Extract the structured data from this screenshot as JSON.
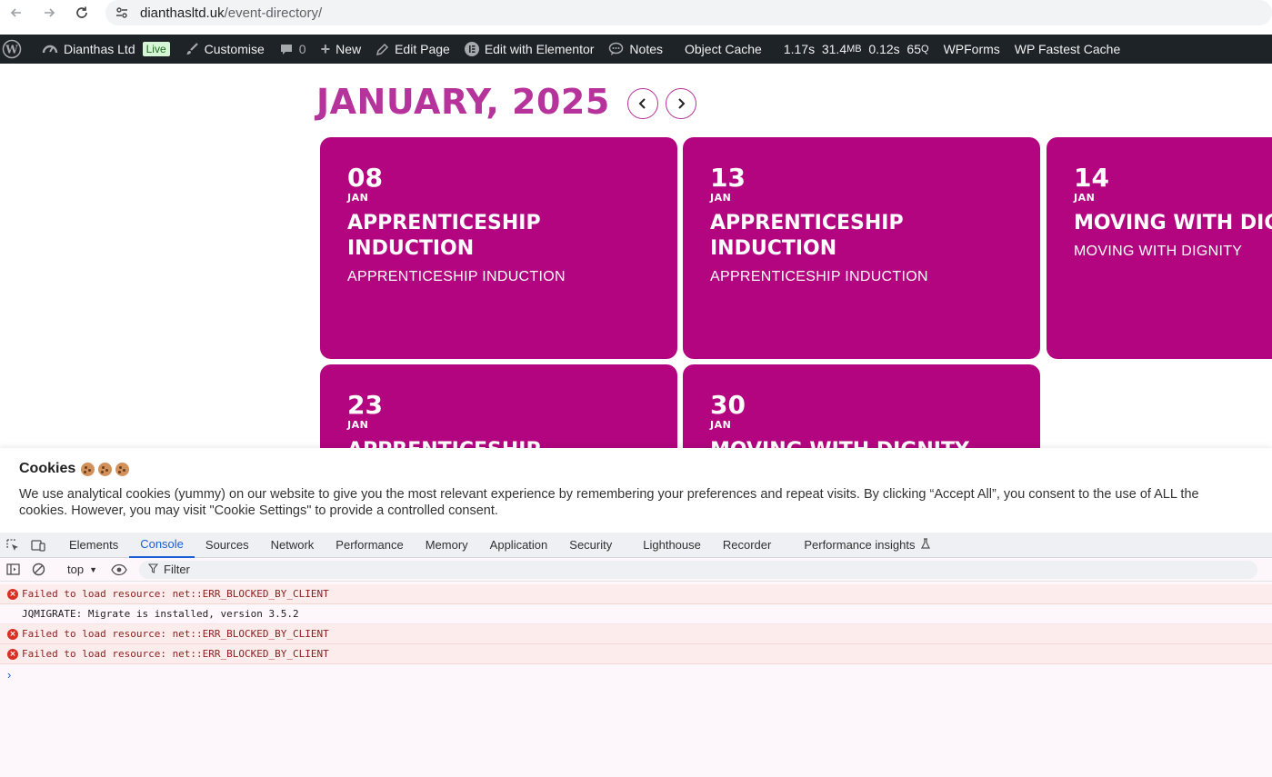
{
  "browser": {
    "url_host": "dianthasltd.uk",
    "url_path": "/event-directory/"
  },
  "adminbar": {
    "site_name": "Dianthas Ltd",
    "live": "Live",
    "customise": "Customise",
    "comments_count": "0",
    "new": "New",
    "edit_page": "Edit Page",
    "edit_elementor": "Edit with Elementor",
    "notes": "Notes",
    "object_cache": "Object Cache",
    "perf_time": "1.17s",
    "perf_mem_value": "31.4",
    "perf_mem_unit": "MB",
    "perf_query_time": "0.12s",
    "perf_queries_value": "65",
    "perf_queries_unit": "Q",
    "wpforms": "WPForms",
    "fastest_cache": "WP Fastest Cache"
  },
  "calendar": {
    "month_title": "JANUARY, 2025",
    "events": [
      {
        "day": "08",
        "month": "JAN",
        "title": "APPRENTICESHIP INDUCTION",
        "subtitle": "APPRENTICESHIP INDUCTION"
      },
      {
        "day": "13",
        "month": "JAN",
        "title": "APPRENTICESHIP INDUCTION",
        "subtitle": "APPRENTICESHIP INDUCTION"
      },
      {
        "day": "14",
        "month": "JAN",
        "title": "MOVING WITH DIGNITY",
        "subtitle": "MOVING WITH DIGNITY"
      },
      {
        "day": "23",
        "month": "JAN",
        "title": "APPRENTICESHIP",
        "subtitle": ""
      },
      {
        "day": "30",
        "month": "JAN",
        "title": "MOVING WITH DIGNITY",
        "subtitle": ""
      }
    ]
  },
  "cookie": {
    "title": "Cookies",
    "text": "We use analytical cookies (yummy) on our website to give you the most relevant experience by remembering your preferences and repeat visits. By clicking “Accept All”, you consent to the use of ALL the cookies. However, you may visit \"Cookie Settings\" to provide a controlled consent."
  },
  "devtools": {
    "tabs": [
      "Elements",
      "Console",
      "Sources",
      "Network",
      "Performance",
      "Memory",
      "Application",
      "Security",
      "Lighthouse",
      "Recorder",
      "Performance insights"
    ],
    "active_tab": "Console",
    "context": "top",
    "filter_placeholder": "Filter",
    "logs": [
      {
        "level": "error",
        "text": "Failed to load resource: net::ERR_BLOCKED_BY_CLIENT"
      },
      {
        "level": "info",
        "text": "JQMIGRATE: Migrate is installed, version 3.5.2"
      },
      {
        "level": "error",
        "text": "Failed to load resource: net::ERR_BLOCKED_BY_CLIENT"
      },
      {
        "level": "error",
        "text": "Failed to load resource: net::ERR_BLOCKED_BY_CLIENT"
      }
    ]
  }
}
